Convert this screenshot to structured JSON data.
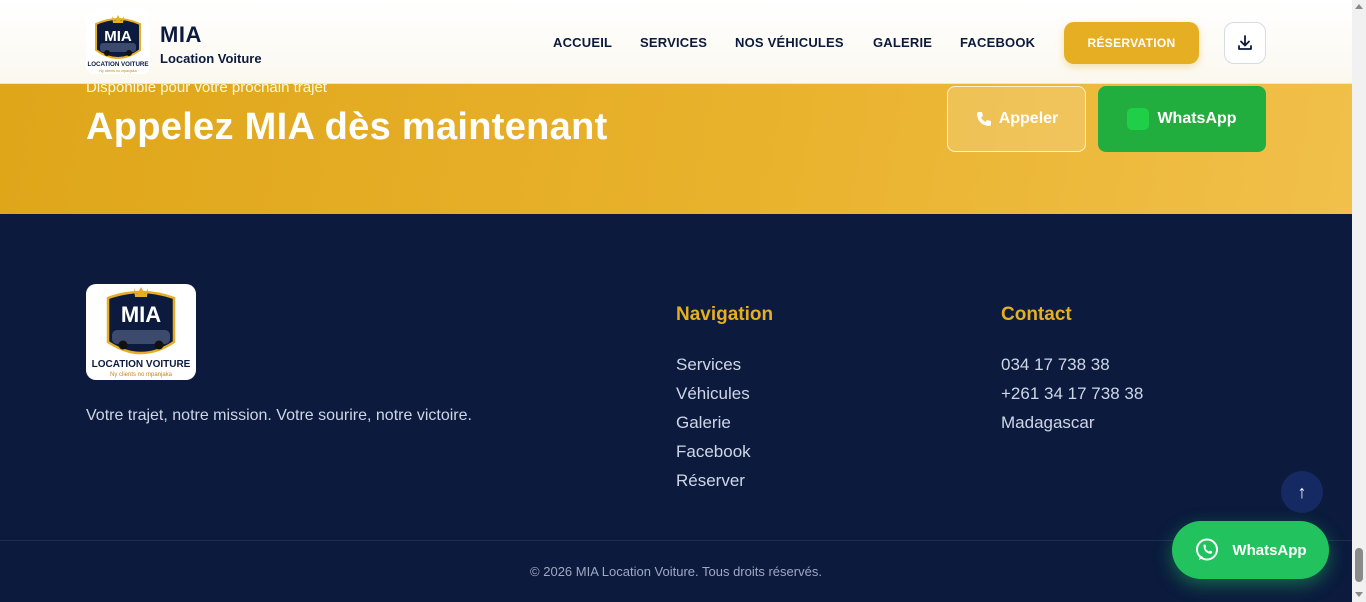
{
  "header": {
    "brand_title": "MIA",
    "brand_subtitle": "Location Voiture",
    "nav": [
      {
        "label": "ACCUEIL"
      },
      {
        "label": "SERVICES"
      },
      {
        "label": "NOS VÉHICULES"
      },
      {
        "label": "GALERIE"
      },
      {
        "label": "FACEBOOK"
      }
    ],
    "reservation_label": "RÉSERVATION",
    "download_icon": "download-icon"
  },
  "cta": {
    "kicker": "Disponible pour votre prochain trajet",
    "title": "Appelez MIA dès maintenant",
    "call_label": "Appeler",
    "whatsapp_label": "WhatsApp"
  },
  "footer": {
    "tagline": "Votre trajet, notre mission. Votre sourire, notre victoire.",
    "navigation_title": "Navigation",
    "navigation_links": [
      "Services",
      "Véhicules",
      "Galerie",
      "Facebook",
      "Réserver"
    ],
    "contact_title": "Contact",
    "contact_lines": [
      "034 17 738 38",
      "+261 34 17 738 38",
      "Madagascar"
    ],
    "copyright": "© 2026 MIA Location Voiture. Tous droits réservés."
  },
  "floating": {
    "whatsapp_label": "WhatsApp",
    "top_arrow": "↑"
  },
  "logo": {
    "text_top": "MIA",
    "text_bottom": "LOCATION VOITURE",
    "slogan": "Ny clients no mpanjaka"
  },
  "colors": {
    "navy": "#0b1a3d",
    "gold": "#e6ae22",
    "whatsapp_green": "#22ae3f"
  }
}
